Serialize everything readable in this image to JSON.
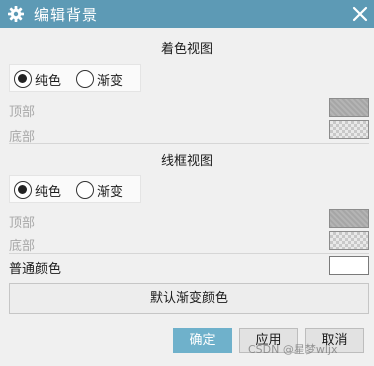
{
  "window": {
    "title": "编辑背景",
    "icon": "gear-icon",
    "accent": "#5d9ab5"
  },
  "shaded_view": {
    "title": "着色视图",
    "options": [
      {
        "label": "纯色",
        "selected": true
      },
      {
        "label": "渐变",
        "selected": false
      }
    ],
    "top_label": "顶部",
    "bottom_label": "底部"
  },
  "wireframe_view": {
    "title": "线框视图",
    "options": [
      {
        "label": "纯色",
        "selected": true
      },
      {
        "label": "渐变",
        "selected": false
      }
    ],
    "top_label": "顶部",
    "bottom_label": "底部"
  },
  "plain_color": {
    "label": "普通颜色",
    "value": "#ffffff"
  },
  "default_gradient_button": "默认渐变颜色",
  "footer": {
    "ok": "确定",
    "apply": "应用",
    "cancel": "取消",
    "ok_color": "#6fb1cb"
  },
  "watermark": "CSDN @星梦wljx"
}
